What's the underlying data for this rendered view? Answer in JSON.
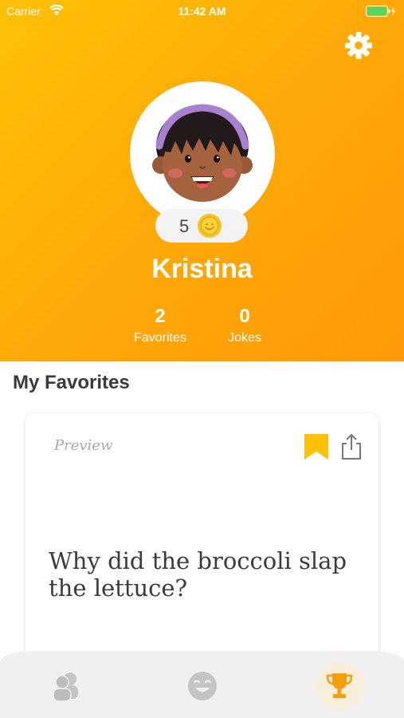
{
  "status_bar": {
    "carrier": "Carrier",
    "time": "11:42 AM"
  },
  "profile": {
    "coins": "5",
    "name": "Kristina",
    "stats": [
      {
        "value": "2",
        "label": "Favorites"
      },
      {
        "value": "0",
        "label": "Jokes"
      }
    ]
  },
  "favorites": {
    "title": "My Favorites",
    "card": {
      "badge": "Preview",
      "text": "Why did the broccoli slap the lettuce?"
    }
  },
  "tabs": [
    {
      "icon": "friends-icon",
      "active": false
    },
    {
      "icon": "laughing-face-icon",
      "active": false
    },
    {
      "icon": "trophy-icon",
      "active": true
    }
  ],
  "colors": {
    "header_gradient_start": "#ffc107",
    "header_gradient_end": "#ff9a08",
    "bookmark": "#ffc107",
    "trophy": "#f5a00a",
    "tab_inactive": "#c4c4c4"
  }
}
